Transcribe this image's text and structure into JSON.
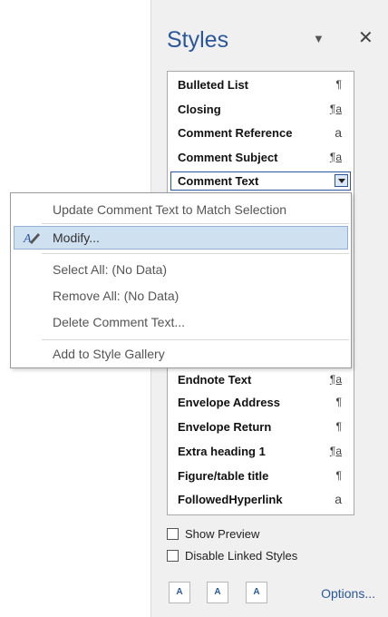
{
  "pane": {
    "title": "Styles",
    "styles": [
      {
        "name": "Bulleted List",
        "type": "¶",
        "kind": "para"
      },
      {
        "name": "Closing",
        "type": "¶a",
        "kind": "linked"
      },
      {
        "name": "Comment Reference",
        "type": "a",
        "kind": "char"
      },
      {
        "name": "Comment Subject",
        "type": "¶a",
        "kind": "linked"
      },
      {
        "name": "Comment Text",
        "type": "",
        "kind": "selected"
      },
      {
        "name": "Endnote Text",
        "type": "¶a",
        "kind": "linked"
      },
      {
        "name": "Envelope Address",
        "type": "¶",
        "kind": "para"
      },
      {
        "name": "Envelope Return",
        "type": "¶",
        "kind": "para"
      },
      {
        "name": "Extra heading 1",
        "type": "¶a",
        "kind": "linked"
      },
      {
        "name": "Figure/table title",
        "type": "¶",
        "kind": "para"
      },
      {
        "name": "FollowedHyperlink",
        "type": "a",
        "kind": "char"
      }
    ],
    "show_preview": "Show Preview",
    "disable_linked": "Disable Linked Styles",
    "options": "Options...",
    "buttons": [
      {
        "label": "A",
        "icon": "new-style-icon"
      },
      {
        "label": "A",
        "icon": "style-inspector-icon"
      },
      {
        "label": "A",
        "icon": "manage-styles-icon"
      }
    ]
  },
  "menu": {
    "items": [
      {
        "label": "Update Comment Text to Match Selection"
      },
      {
        "label": "Modify..."
      },
      {
        "label": "Select All: (No Data)"
      },
      {
        "label": "Remove All: (No Data)"
      },
      {
        "label": "Delete Comment Text..."
      },
      {
        "label": "Add to Style Gallery"
      }
    ]
  },
  "colors": {
    "accent": "#2b579a",
    "highlight": "#cfe0f1"
  }
}
